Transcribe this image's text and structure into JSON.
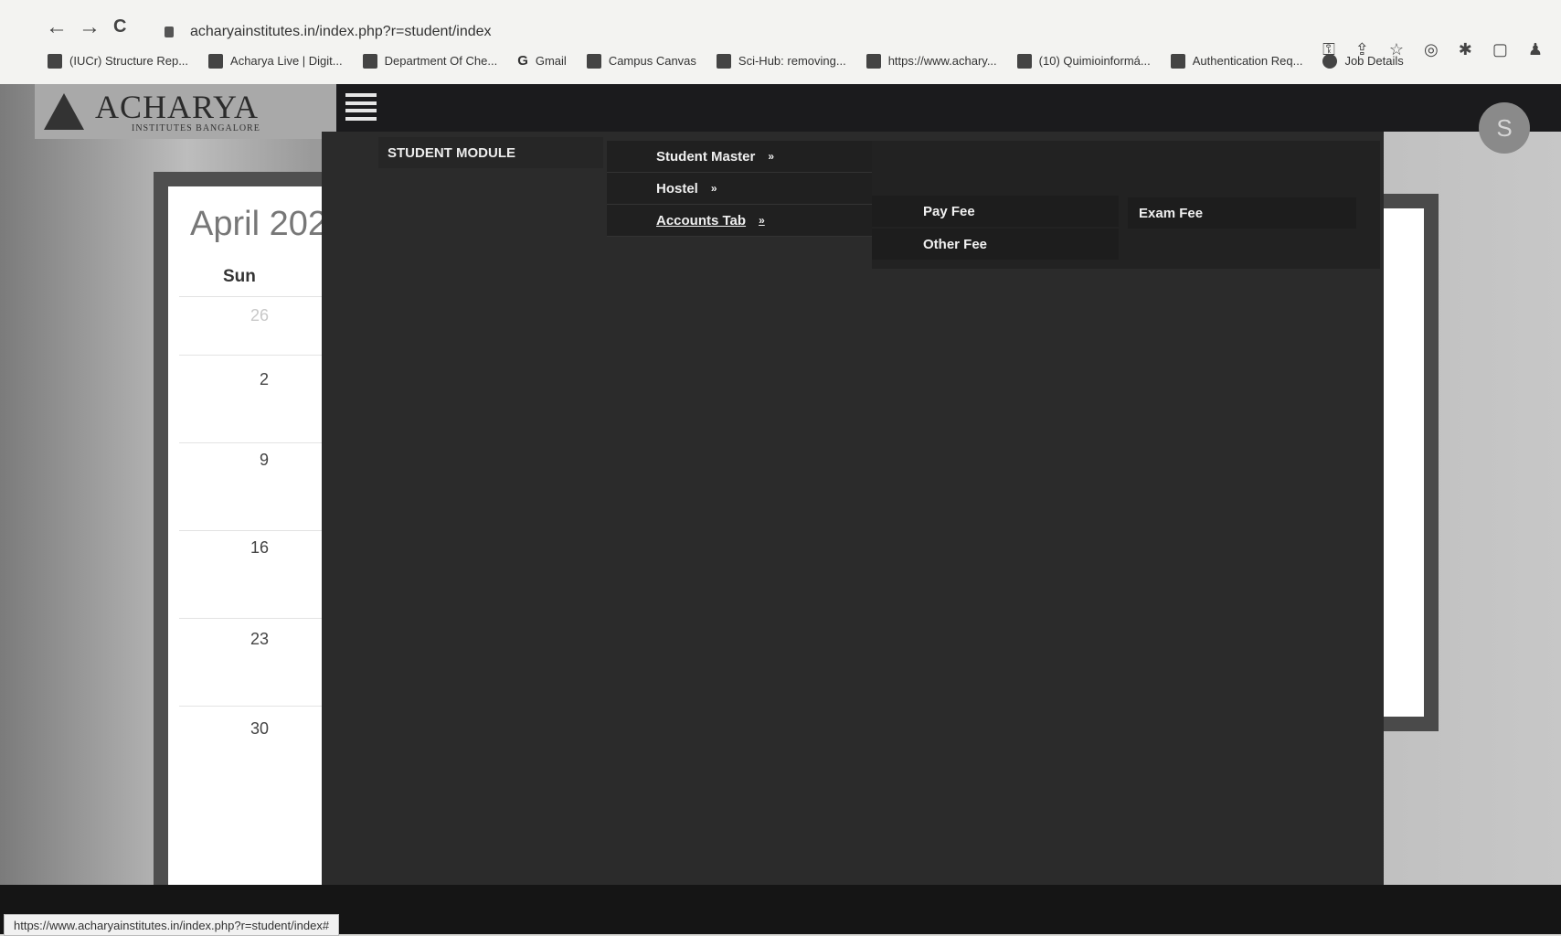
{
  "browser": {
    "url": "acharyainstitutes.in/index.php?r=student/index",
    "nav": {
      "back": "←",
      "forward": "→",
      "reload": "C"
    },
    "bookmarks": [
      {
        "label": "(IUCr) Structure Rep...",
        "icon": "grid-icon"
      },
      {
        "label": "Acharya Live | Digit...",
        "icon": "drive-icon"
      },
      {
        "label": "Department Of Che...",
        "icon": "page-icon"
      },
      {
        "label": "Gmail",
        "icon": "google-icon"
      },
      {
        "label": "Campus Canvas",
        "icon": "canvas-icon"
      },
      {
        "label": "Sci-Hub: removing...",
        "icon": "scihub-icon"
      },
      {
        "label": "https://www.achary...",
        "icon": "link-icon"
      },
      {
        "label": "(10) Quimioinformá...",
        "icon": "bookmark-icon"
      },
      {
        "label": "Authentication Req...",
        "icon": "auth-icon"
      },
      {
        "label": "Job Details",
        "icon": "globe-icon"
      }
    ],
    "status_url": "https://www.acharyainstitutes.in/index.php?r=student/index#"
  },
  "logo": {
    "title": "ACHARYA",
    "subtitle": "INSTITUTES BANGALORE"
  },
  "avatar": {
    "initial": "S"
  },
  "calendar": {
    "month": "April 202",
    "day_header": "Sun",
    "dates": [
      "26",
      "2",
      "9",
      "16",
      "23",
      "30"
    ]
  },
  "menu": {
    "module_label": "STUDENT MODULE",
    "items": [
      {
        "label": "Student Master",
        "arrow": "»"
      },
      {
        "label": "Hostel",
        "arrow": "»"
      },
      {
        "label": "Accounts Tab",
        "arrow": "»"
      }
    ],
    "flyout": [
      "Pay Fee",
      "Exam Fee",
      "Other Fee"
    ]
  }
}
